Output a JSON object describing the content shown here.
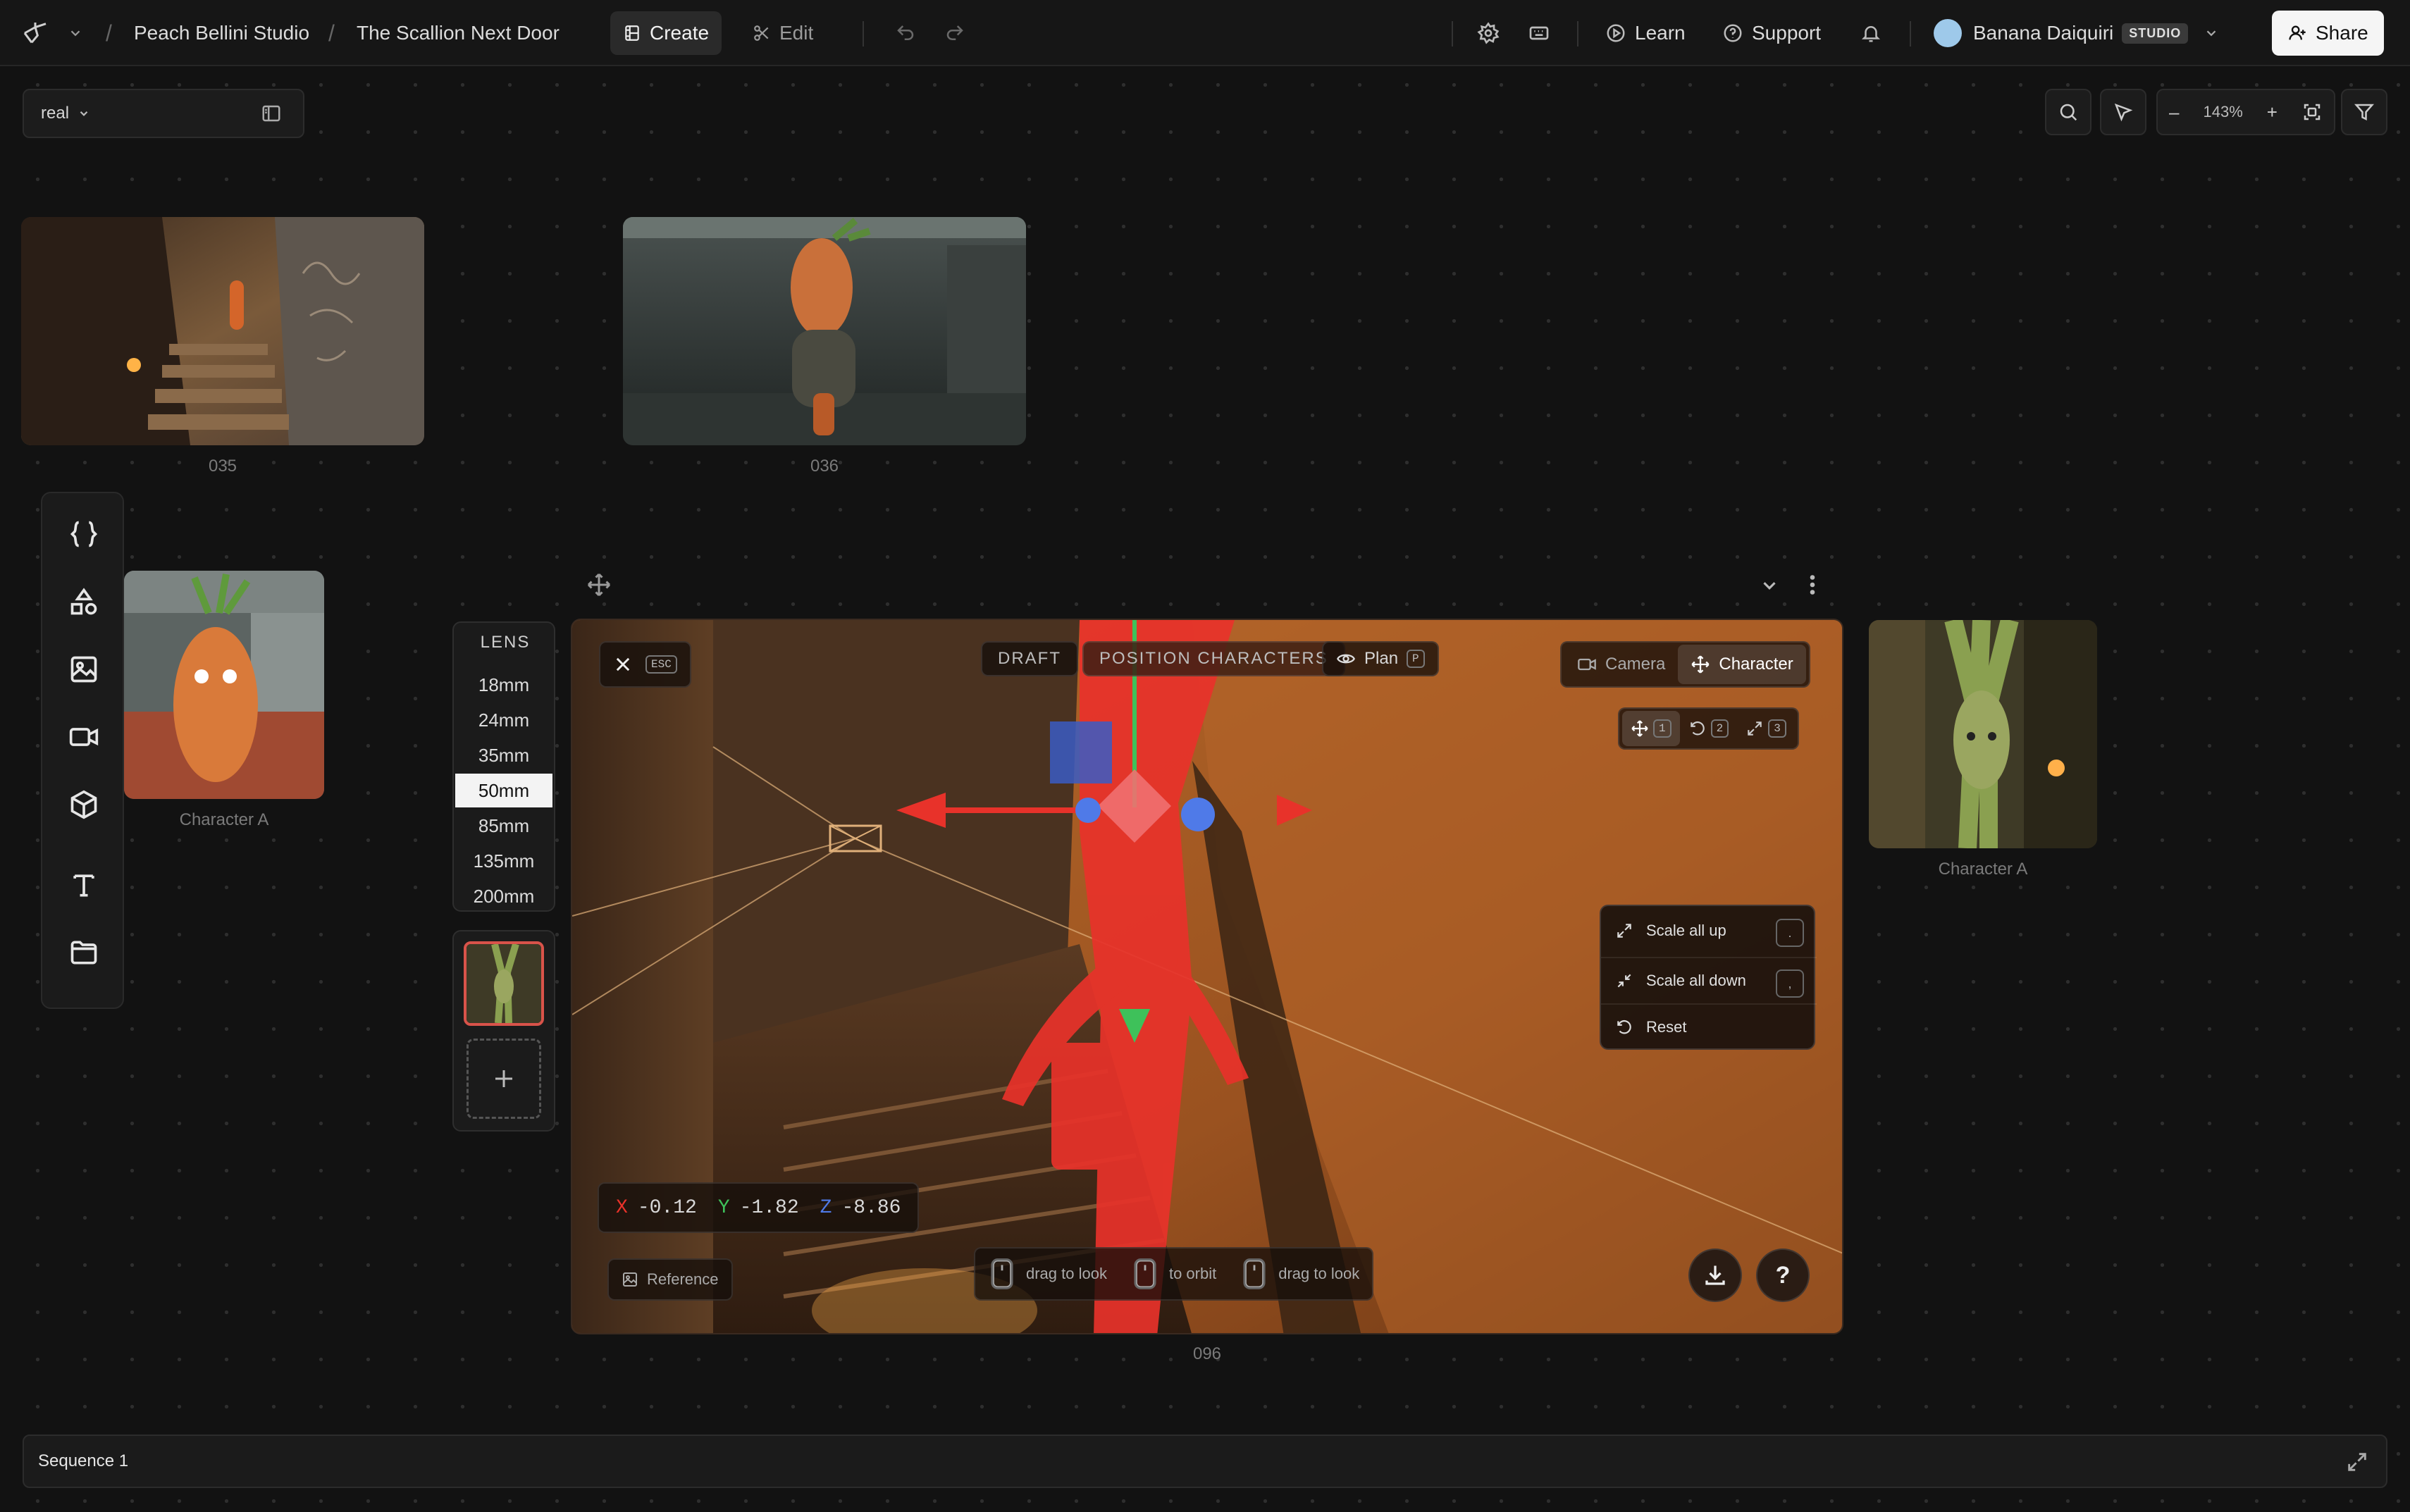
{
  "topbar": {
    "org": "Peach Bellini Studio",
    "project": "The Scallion Next Door",
    "create_label": "Create",
    "edit_label": "Edit",
    "learn_label": "Learn",
    "support_label": "Support",
    "user_name": "Banana Daiquiri",
    "user_badge": "STUDIO",
    "share_label": "Share"
  },
  "subbar": {
    "style_select": "real",
    "zoom_level": "143%",
    "zoom_minus": "–",
    "zoom_plus": "+"
  },
  "canvas": {
    "shots": [
      {
        "label": "035"
      },
      {
        "label": "036"
      },
      {
        "label": "Character A"
      },
      {
        "label": "Character A"
      }
    ],
    "viewport_label": "096"
  },
  "lens": {
    "title": "LENS",
    "options": [
      "18mm",
      "24mm",
      "35mm",
      "50mm",
      "85mm",
      "135mm",
      "200mm"
    ],
    "selected": "50mm"
  },
  "viewport": {
    "close_kbd": "ESC",
    "mode_draft": "DRAFT",
    "mode_position": "POSITION CHARACTERS",
    "plan_label": "Plan",
    "plan_kbd": "P",
    "camera_tab": "Camera",
    "character_tab": "Character",
    "tool_move_kbd": "1",
    "tool_rotate_kbd": "2",
    "tool_scale_kbd": "3",
    "scale_menu": [
      {
        "label": "Scale all up",
        "kbd": "."
      },
      {
        "label": "Scale all down",
        "kbd": ","
      },
      {
        "label": "Reset",
        "kbd": ""
      }
    ],
    "coords": {
      "x_label": "X",
      "x": "-0.12",
      "y_label": "Y",
      "y": "-1.82",
      "z_label": "Z",
      "z": "-8.86"
    },
    "reference_label": "Reference",
    "hints": [
      "drag to look",
      "to orbit",
      "drag to look"
    ],
    "help_label": "?"
  },
  "sequence": {
    "label": "Sequence 1"
  },
  "colors": {
    "accent_red": "#e8322a",
    "axis_blue": "#4f7ae8",
    "axis_green": "#3ec15a",
    "background": "#121212"
  }
}
